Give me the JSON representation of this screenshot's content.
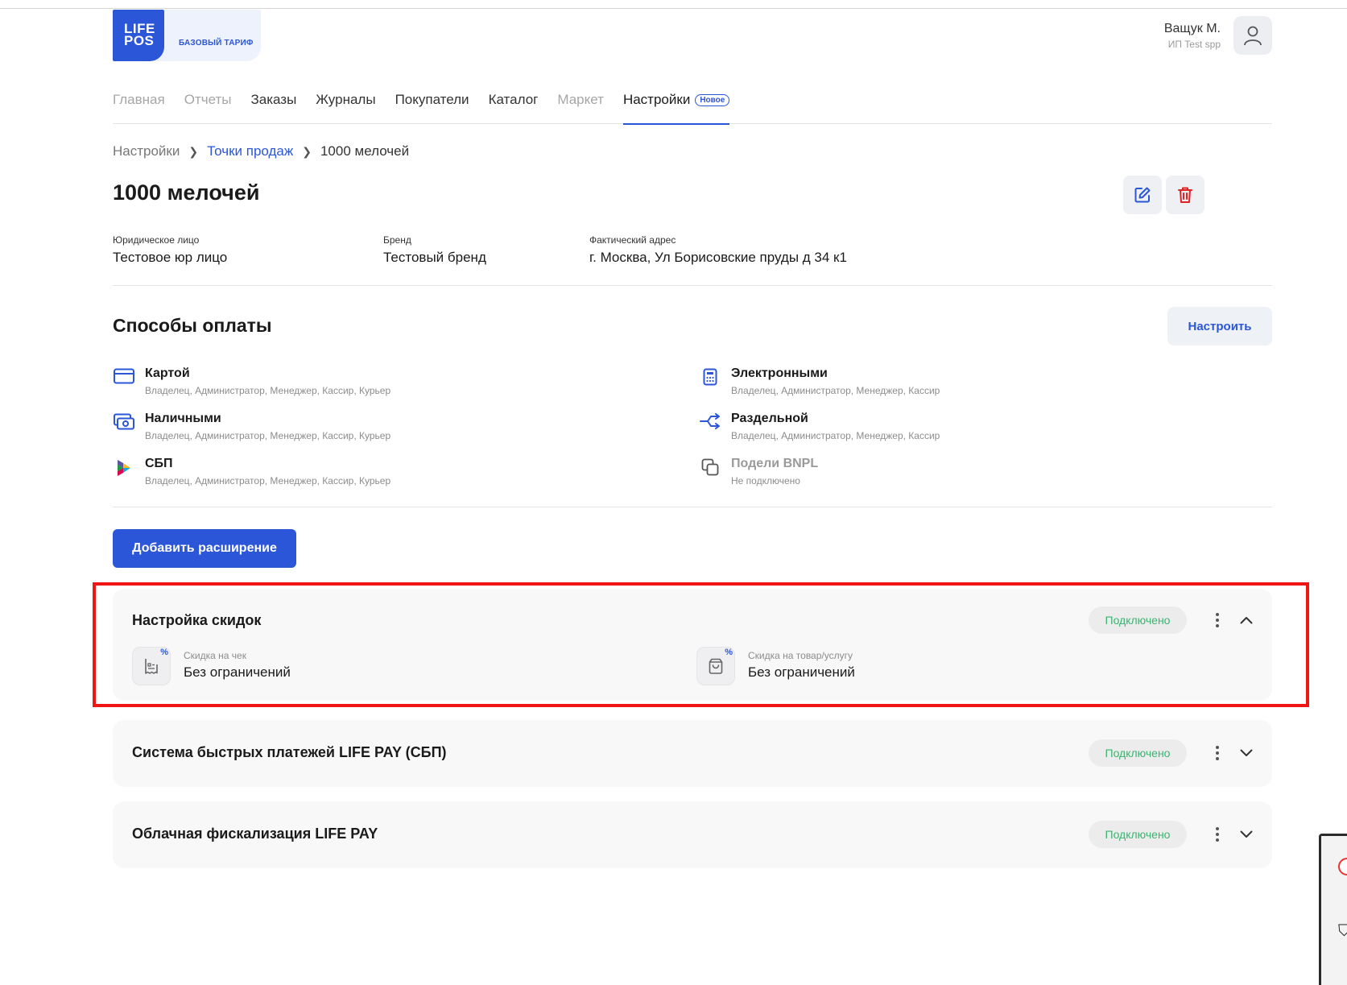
{
  "logo": {
    "line1": "LIFE",
    "line2": "POS",
    "plan": "БАЗОВЫЙ ТАРИФ"
  },
  "user": {
    "name": "Ващук М.",
    "org": "ИП Test spp"
  },
  "nav": [
    {
      "label": "Главная",
      "state": "muted"
    },
    {
      "label": "Отчеты",
      "state": "muted"
    },
    {
      "label": "Заказы",
      "state": "normal"
    },
    {
      "label": "Журналы",
      "state": "normal"
    },
    {
      "label": "Покупатели",
      "state": "normal"
    },
    {
      "label": "Каталог",
      "state": "normal"
    },
    {
      "label": "Маркет",
      "state": "muted"
    },
    {
      "label": "Настройки",
      "state": "active",
      "badge": "Новое"
    }
  ],
  "breadcrumb": {
    "root": "Настройки",
    "parent": "Точки продаж",
    "current": "1000 мелочей"
  },
  "page_title": "1000 мелочей",
  "info": {
    "legal_label": "Юридическое лицо",
    "legal_value": "Тестовое юр лицо",
    "brand_label": "Бренд",
    "brand_value": "Тестовый бренд",
    "address_label": "Фактический адрес",
    "address_value": "г. Москва, Ул Борисовские пруды д 34 к1"
  },
  "payments": {
    "title": "Способы оплаты",
    "setup_label": "Настроить",
    "items": [
      {
        "name": "Картой",
        "roles": "Владелец, Администратор, Менеджер, Кассир, Курьер",
        "icon": "card-icon"
      },
      {
        "name": "Наличными",
        "roles": "Владелец, Администратор, Менеджер, Кассир, Курьер",
        "icon": "cash-icon"
      },
      {
        "name": "СБП",
        "roles": "Владелец, Администратор, Менеджер, Кассир, Курьер",
        "icon": "sbp-icon"
      },
      {
        "name": "Электронными",
        "roles": "Владелец, Администратор, Менеджер, Кассир",
        "icon": "calculator-icon"
      },
      {
        "name": "Раздельной",
        "roles": "Владелец, Администратор, Менеджер, Кассир",
        "icon": "split-icon"
      },
      {
        "name": "Подели BNPL",
        "roles": "Не подключено",
        "icon": "copy-icon",
        "disabled": true
      }
    ]
  },
  "add_extension_label": "Добавить расширение",
  "extensions": [
    {
      "title": "Настройка скидок",
      "status": "Подключено",
      "expanded": true,
      "discounts": [
        {
          "label": "Скидка на чек",
          "value": "Без ограничений",
          "badge": "%",
          "icon": "receipt-icon"
        },
        {
          "label": "Скидка на товар/услугу",
          "value": "Без ограничений",
          "badge": "%",
          "icon": "bag-icon"
        }
      ]
    },
    {
      "title": "Система быстрых платежей LIFE PAY (СБП)",
      "status": "Подключено",
      "expanded": false
    },
    {
      "title": "Облачная фискализация LIFE PAY",
      "status": "Подключено",
      "expanded": false
    }
  ],
  "colors": {
    "accent": "#2b56d8",
    "status_green": "#3cb371",
    "danger": "#e02424",
    "highlight": "#f01414"
  }
}
